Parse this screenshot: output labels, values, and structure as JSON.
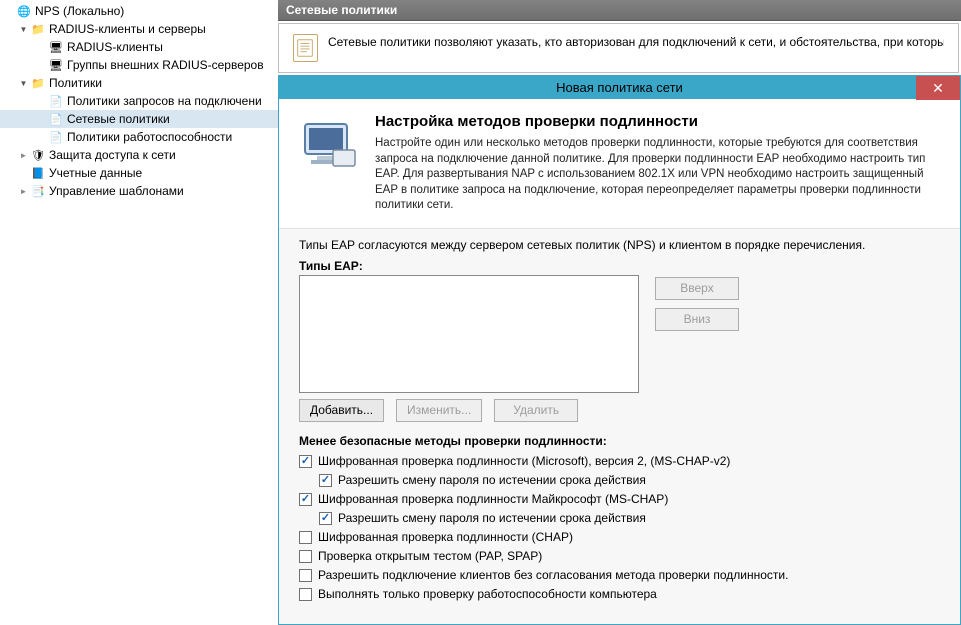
{
  "tree": {
    "root": "NPS (Локально)",
    "radius_group": "RADIUS-клиенты и серверы",
    "radius_clients": "RADIUS-клиенты",
    "ext_radius": "Группы внешних RADIUS-серверов",
    "policies": "Политики",
    "conn_req": "Политики запросов на подключени",
    "net_pol": "Сетевые политики",
    "health_pol": "Политики работоспособности",
    "nap": "Защита доступа к сети",
    "accounting": "Учетные данные",
    "templates": "Управление шаблонами"
  },
  "header": {
    "title": "Сетевые политики"
  },
  "info": {
    "text": "Сетевые политики позволяют указать, кто авторизован для подключений к сети, и обстоятельства, при которых можно или н"
  },
  "wizard": {
    "title": "Новая политика сети",
    "heading": "Настройка методов проверки подлинности",
    "desc": "Настройте один или несколько методов проверки подлинности, которые требуются для соответствия запроса на подключение данной политике. Для проверки подлинности EAP необходимо настроить тип EAP. Для развертывания NAP с использованием 802.1X или VPN необходимо настроить защищенный EAP в политике запроса на подключение, которая переопределяет параметры проверки подлинности политики сети.",
    "note": "Типы EAP согласуются между сервером сетевых политик (NPS) и клиентом в порядке перечисления.",
    "eap_label": "Типы EAP:",
    "btn_up": "Вверх",
    "btn_down": "Вниз",
    "btn_add": "Добавить...",
    "btn_edit": "Изменить...",
    "btn_del": "Удалить",
    "less_secure_label": "Менее безопасные методы проверки подлинности:",
    "chk1": "Шифрованная проверка подлинности (Microsoft), версия 2, (MS-CHAP-v2)",
    "chk1a": "Разрешить смену пароля по истечении срока действия",
    "chk2": "Шифрованная проверка подлинности Майкрософт (MS-CHAP)",
    "chk2a": "Разрешить смену пароля по истечении срока действия",
    "chk3": "Шифрованная проверка подлинности (CHAP)",
    "chk4": "Проверка открытым тестом (PAP, SPAP)",
    "chk5": "Разрешить подключение клиентов без согласования метода проверки подлинности.",
    "chk6": "Выполнять только проверку работоспособности компьютера"
  }
}
